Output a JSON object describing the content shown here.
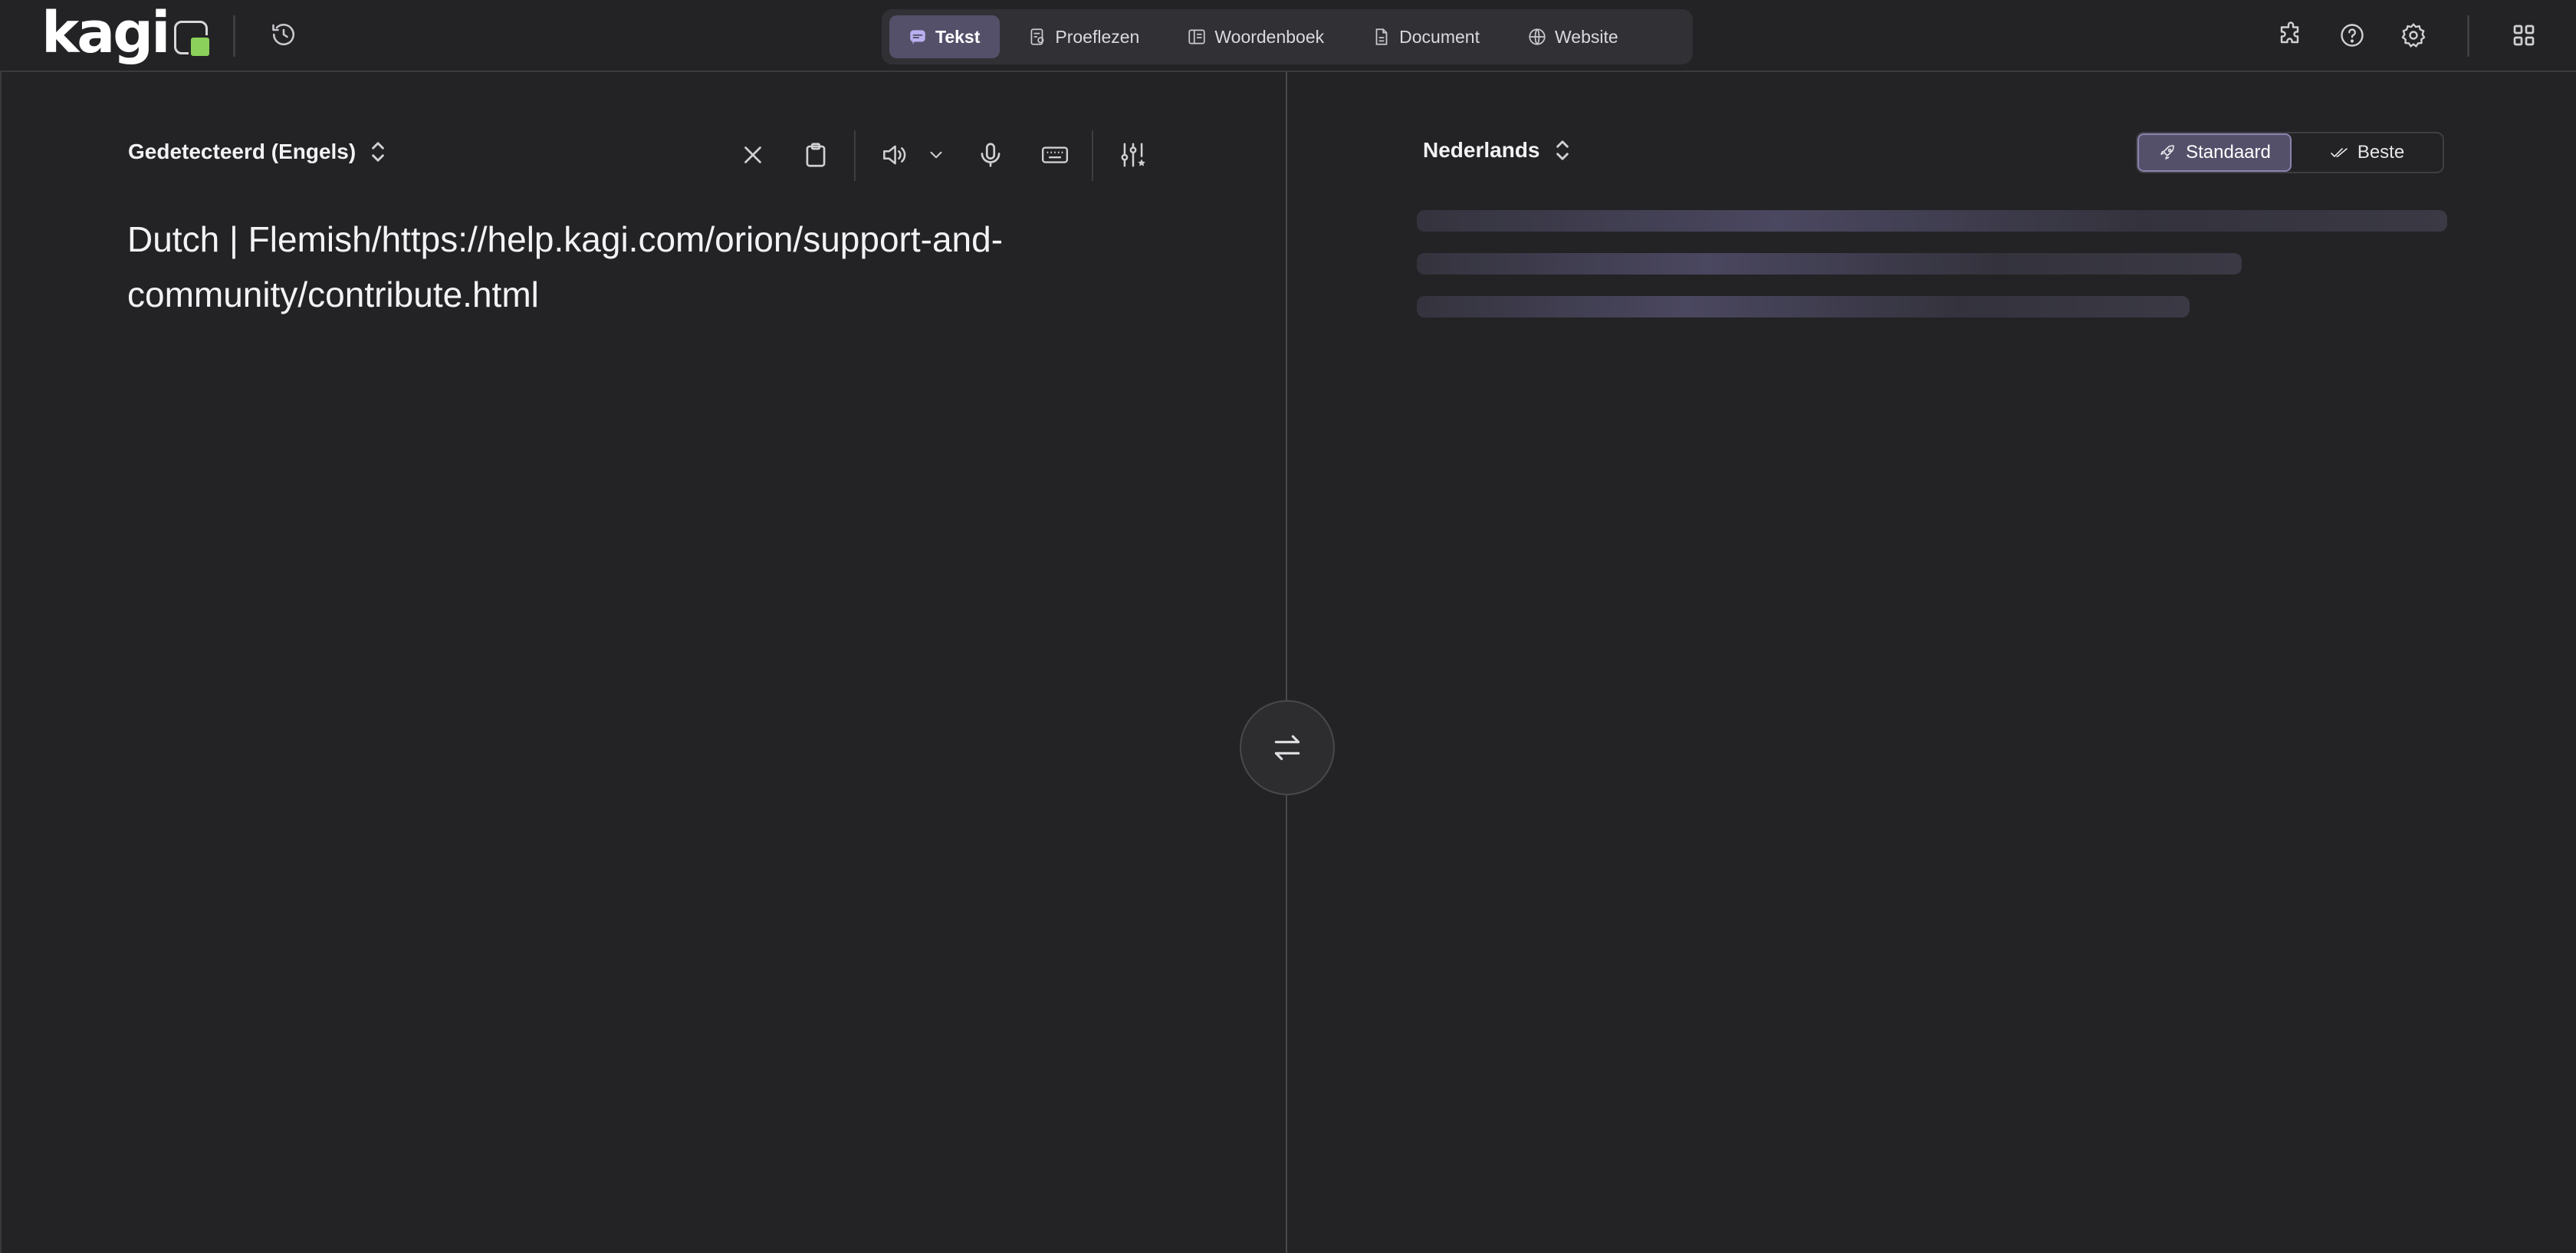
{
  "app": {
    "logo_text": "kagi",
    "brand_color": "#8bd05a",
    "accent_color": "#55506a"
  },
  "header": {
    "history_icon": "history-icon",
    "modes": [
      {
        "label": "Tekst",
        "icon": "chat-icon",
        "active": true
      },
      {
        "label": "Proeflezen",
        "icon": "proofread-icon",
        "active": false
      },
      {
        "label": "Woordenboek",
        "icon": "book-icon",
        "active": false
      },
      {
        "label": "Document",
        "icon": "document-icon",
        "active": false
      },
      {
        "label": "Website",
        "icon": "globe-icon",
        "active": false
      }
    ],
    "right_icons": [
      "extension-icon",
      "help-icon",
      "settings-icon",
      "apps-grid-icon"
    ]
  },
  "source": {
    "language": "Gedetecteerd (Engels)",
    "text": "Dutch |  Flemish/https://help.kagi.com/orion/support-and-community/contribute.html",
    "tools": [
      "close-icon",
      "clipboard-icon",
      "speaker-icon",
      "chevron-down-icon",
      "microphone-icon",
      "keyboard-icon",
      "sliders-icon"
    ]
  },
  "target": {
    "language": "Nederlands",
    "quality_options": [
      {
        "label": "Standaard",
        "icon": "rocket-icon",
        "active": true
      },
      {
        "label": "Beste",
        "icon": "double-check-icon",
        "active": false
      }
    ],
    "loading": true
  },
  "swap": {
    "icon": "swap-arrows-icon"
  }
}
